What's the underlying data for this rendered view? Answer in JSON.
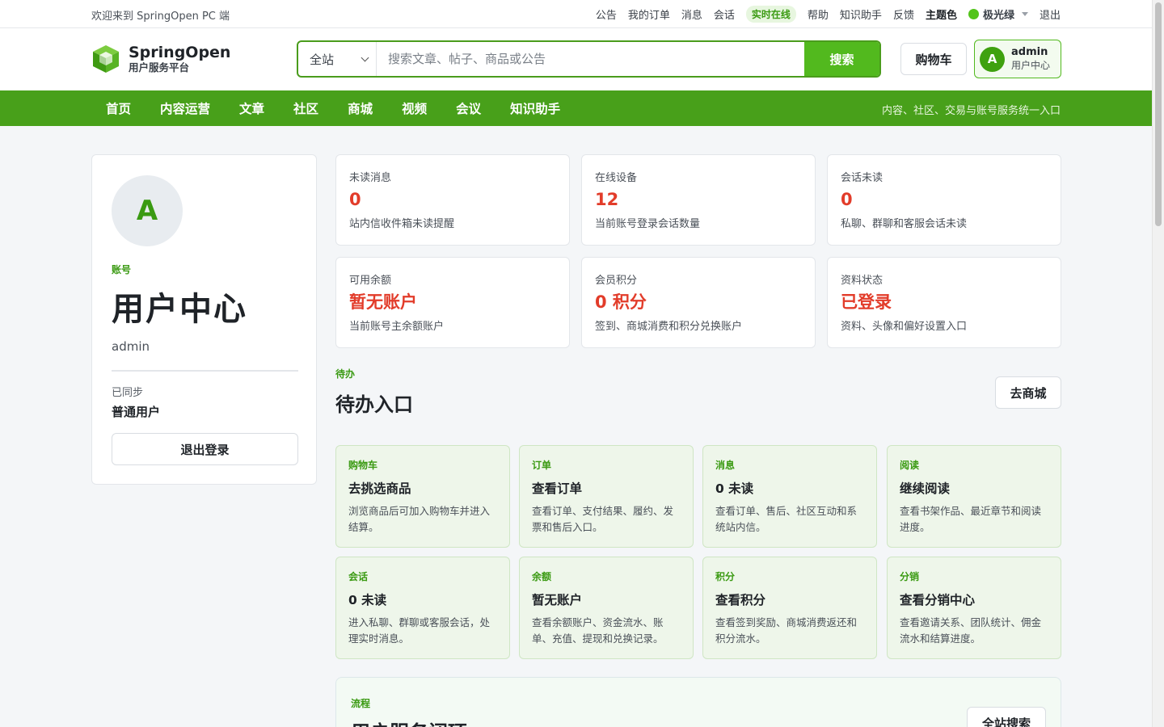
{
  "topbar": {
    "welcome": "欢迎来到 SpringOpen PC 端",
    "links": [
      "公告",
      "我的订单",
      "消息",
      "会话"
    ],
    "live_badge": "实时在线",
    "links2": [
      "帮助",
      "知识助手",
      "反馈"
    ],
    "theme_label": "主题色",
    "theme_name": "极光绿",
    "theme_color": "#52c41a",
    "logout": "退出"
  },
  "header": {
    "brand_name": "SpringOpen",
    "brand_sub": "用户服务平台",
    "search_scope": "全站",
    "search_placeholder": "搜索文章、帖子、商品或公告",
    "search_button": "搜索",
    "cart": "购物车",
    "user_avatar": "A",
    "user_name": "admin",
    "user_sub": "用户中心"
  },
  "nav": {
    "items": [
      "首页",
      "内容运营",
      "文章",
      "社区",
      "商城",
      "视频",
      "会议",
      "知识助手"
    ],
    "tagline": "内容、社区、交易与账号服务统一入口",
    "color": "#48a01a"
  },
  "profile": {
    "avatar": "A",
    "kicker": "账号",
    "title": "用户中心",
    "username": "admin",
    "sync": "已同步",
    "role": "普通用户",
    "logout": "退出登录"
  },
  "stats": [
    {
      "label": "未读消息",
      "value": "0",
      "desc": "站内信收件箱未读提醒"
    },
    {
      "label": "在线设备",
      "value": "12",
      "desc": "当前账号登录会话数量"
    },
    {
      "label": "会话未读",
      "value": "0",
      "desc": "私聊、群聊和客服会话未读"
    },
    {
      "label": "可用余额",
      "value": "暂无账户",
      "desc": "当前账号主余额账户"
    },
    {
      "label": "会员积分",
      "value": "0 积分",
      "desc": "签到、商城消费和积分兑换账户"
    },
    {
      "label": "资料状态",
      "value": "已登录",
      "desc": "资料、头像和偏好设置入口"
    }
  ],
  "todo": {
    "kicker": "待办",
    "title": "待办入口",
    "button": "去商城",
    "cards": [
      {
        "tag": "购物车",
        "head": "去挑选商品",
        "desc": "浏览商品后可加入购物车并进入结算。"
      },
      {
        "tag": "订单",
        "head": "查看订单",
        "desc": "查看订单、支付结果、履约、发票和售后入口。"
      },
      {
        "tag": "消息",
        "head": "0 未读",
        "desc": "查看订单、售后、社区互动和系统站内信。"
      },
      {
        "tag": "阅读",
        "head": "继续阅读",
        "desc": "查看书架作品、最近章节和阅读进度。"
      },
      {
        "tag": "会话",
        "head": "0 未读",
        "desc": "进入私聊、群聊或客服会话，处理实时消息。"
      },
      {
        "tag": "余额",
        "head": "暂无账户",
        "desc": "查看余额账户、资金流水、账单、充值、提现和兑换记录。"
      },
      {
        "tag": "积分",
        "head": "查看积分",
        "desc": "查看签到奖励、商城消费返还和积分流水。"
      },
      {
        "tag": "分销",
        "head": "查看分销中心",
        "desc": "查看邀请关系、团队统计、佣金流水和结算进度。"
      }
    ]
  },
  "flow": {
    "kicker": "流程",
    "title": "用户服务闭环",
    "button": "全站搜索"
  }
}
